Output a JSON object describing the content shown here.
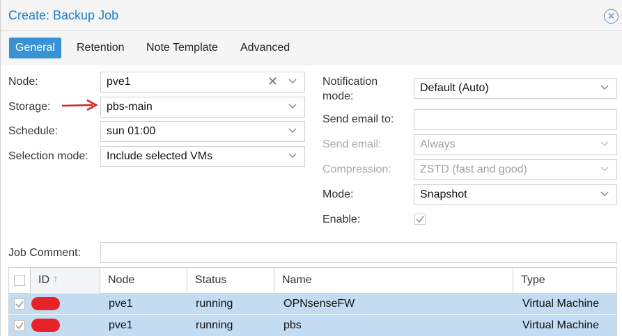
{
  "dialog": {
    "title": "Create: Backup Job",
    "close_glyph": "✕"
  },
  "tabs": [
    {
      "label": "General",
      "active": true
    },
    {
      "label": "Retention",
      "active": false
    },
    {
      "label": "Note Template",
      "active": false
    },
    {
      "label": "Advanced",
      "active": false
    }
  ],
  "left_form": {
    "node": {
      "label": "Node:",
      "value": "pve1",
      "clear": "✕"
    },
    "storage": {
      "label": "Storage:",
      "value": "pbs-main"
    },
    "schedule": {
      "label": "Schedule:",
      "value": "sun 01:00"
    },
    "selection_mode": {
      "label": "Selection mode:",
      "value": "Include selected VMs"
    }
  },
  "right_form": {
    "notification_mode": {
      "label_line1": "Notification",
      "label_line2": "mode:",
      "value": "Default (Auto)"
    },
    "send_email_to": {
      "label": "Send email to:",
      "value": ""
    },
    "send_email": {
      "label": "Send email:",
      "value": "Always",
      "disabled": true
    },
    "compression": {
      "label": "Compression:",
      "value": "ZSTD (fast and good)",
      "disabled": true
    },
    "mode": {
      "label": "Mode:",
      "value": "Snapshot"
    },
    "enable": {
      "label": "Enable:",
      "checked": true
    }
  },
  "job_comment": {
    "label": "Job Comment:",
    "value": ""
  },
  "grid": {
    "columns": [
      "ID",
      "Node",
      "Status",
      "Name",
      "Type"
    ],
    "sort_indicator": "↑",
    "rows": [
      {
        "id": "",
        "node": "pve1",
        "status": "running",
        "name": "OPNsenseFW",
        "type": "Virtual Machine",
        "selected": true
      },
      {
        "id": "",
        "node": "pve1",
        "status": "running",
        "name": "pbs",
        "type": "Virtual Machine",
        "selected": true
      }
    ]
  },
  "colors": {
    "accent": "#3892d4",
    "title": "#1f7dc7",
    "row_selected": "#c3dcf2",
    "annotation_arrow": "#d42020",
    "redaction": "#e8222a"
  }
}
